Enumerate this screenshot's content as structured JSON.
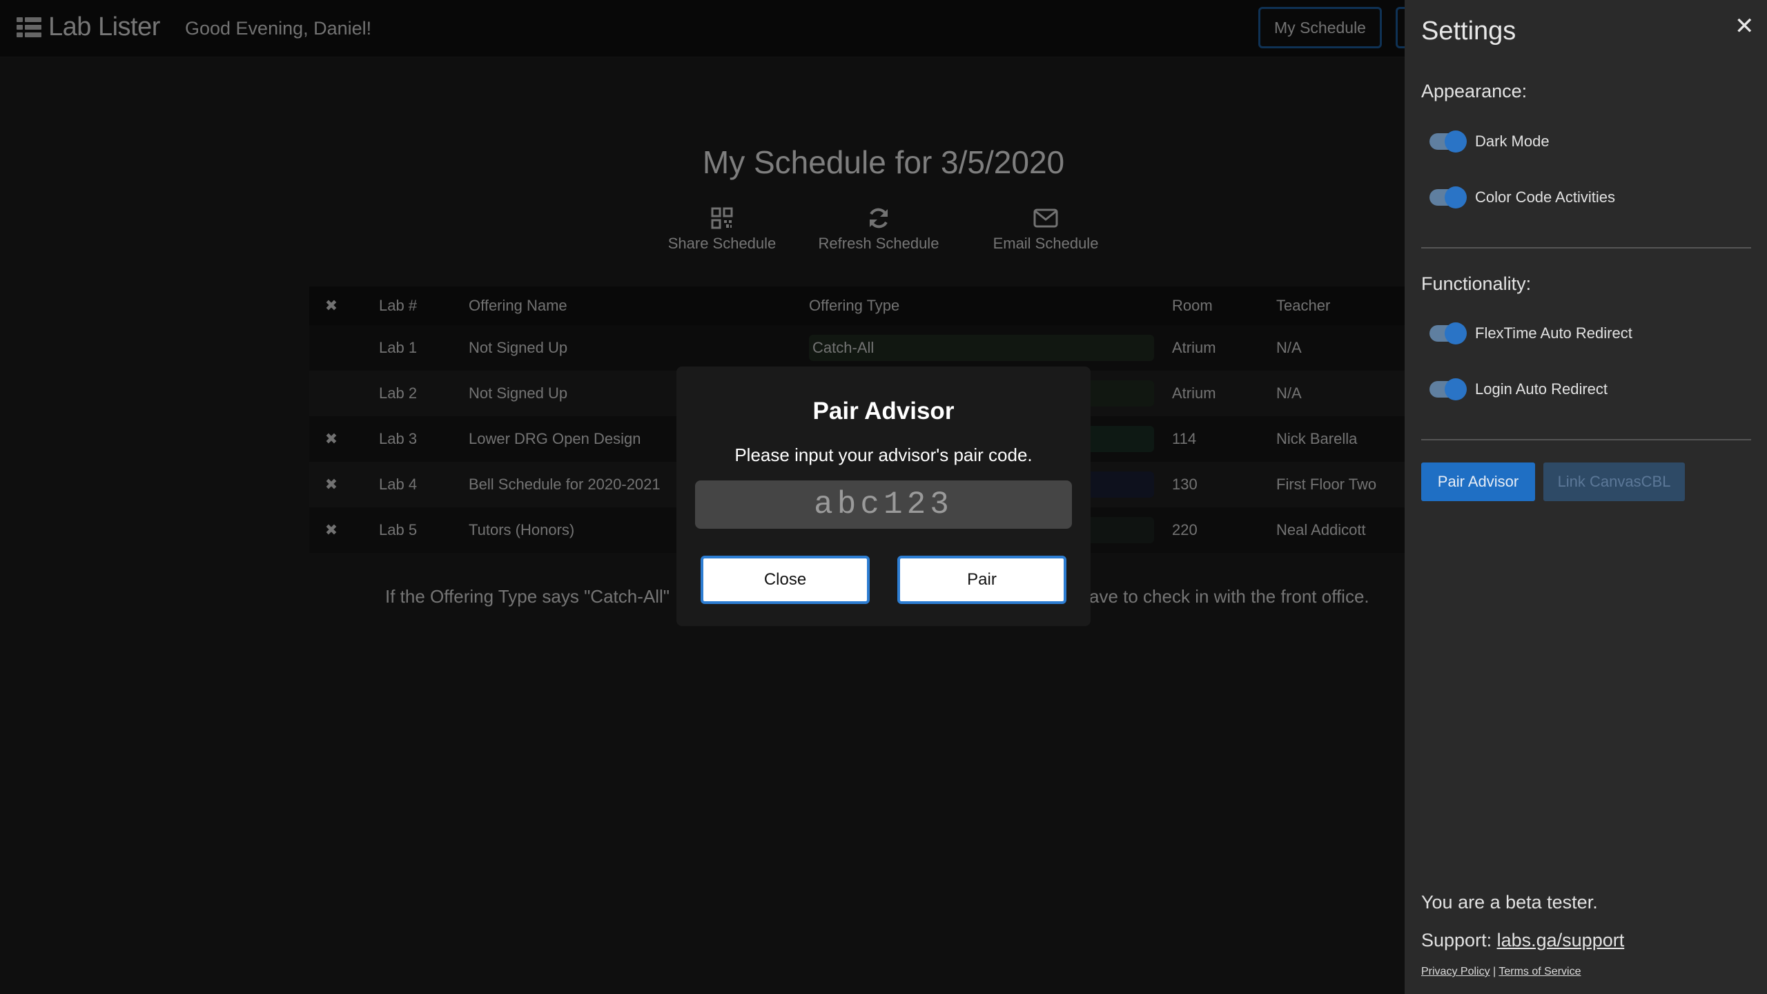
{
  "header": {
    "brand": "Lab Lister",
    "greeting": "Good Evening, Daniel!",
    "nav_my_schedule": "My Schedule"
  },
  "schedule": {
    "title": "My Schedule for 3/5/2020",
    "actions": {
      "share": "Share Schedule",
      "refresh": "Refresh Schedule",
      "email": "Email Schedule"
    },
    "columns": {
      "remove": "✖",
      "lab": "Lab #",
      "name": "Offering Name",
      "type": "Offering Type",
      "room": "Room",
      "teacher": "Teacher"
    },
    "rows": [
      {
        "remove": "",
        "lab": "Lab 1",
        "name": "Not Signed Up",
        "type": "Catch-All",
        "room": "Atrium",
        "teacher": "N/A",
        "type_color": "#1f2b1f"
      },
      {
        "remove": "",
        "lab": "Lab 2",
        "name": "Not Signed Up",
        "type": "",
        "room": "Atrium",
        "teacher": "N/A",
        "type_color": "#1f2b1f"
      },
      {
        "remove": "✖",
        "lab": "Lab 3",
        "name": "Lower DRG Open Design",
        "type": "",
        "room": "114",
        "teacher": "Nick Barella",
        "type_color": "#1a2f25"
      },
      {
        "remove": "✖",
        "lab": "Lab 4",
        "name": "Bell Schedule for 2020-2021",
        "type": "",
        "room": "130",
        "teacher": "First Floor Two",
        "type_color": "#1a1f35"
      },
      {
        "remove": "✖",
        "lab": "Lab 5",
        "name": "Tutors (Honors)",
        "type": "",
        "room": "220",
        "teacher": "Neal Addicott",
        "type_color": "#1c2320"
      }
    ],
    "note_start": "If the Offering Type says \"Catch-All\"",
    "note_end": "ave to check in with the front office."
  },
  "modal": {
    "title": "Pair Advisor",
    "subtitle": "Please input your advisor's pair code.",
    "placeholder": "abc123",
    "close_label": "Close",
    "pair_label": "Pair"
  },
  "settings": {
    "title": "Settings",
    "close": "✕",
    "appearance_label": "Appearance:",
    "dark_mode": "Dark Mode",
    "color_code": "Color Code Activities",
    "functionality_label": "Functionality:",
    "flextime": "FlexTime Auto Redirect",
    "login_redirect": "Login Auto Redirect",
    "pair_advisor_btn": "Pair Advisor",
    "link_canvas_btn": "Link CanvasCBL",
    "beta": "You are a beta tester.",
    "support_label": "Support:",
    "support_link": "labs.ga/support",
    "privacy": "Privacy Policy",
    "separator": "|",
    "terms": "Terms of Service",
    "toggles_on": true
  },
  "colors": {
    "accent": "#2a74c6",
    "modal_border": "#2d7dd2"
  }
}
